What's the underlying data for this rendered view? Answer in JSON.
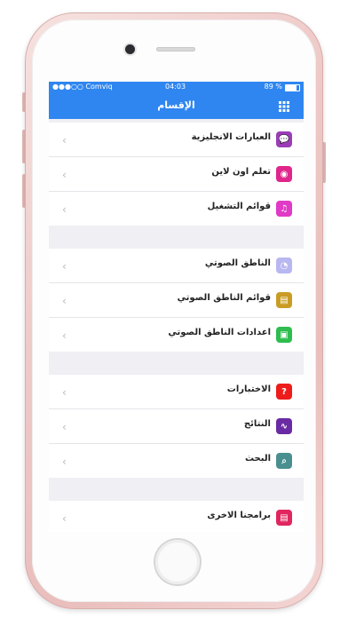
{
  "status": {
    "carrier": "●●●○○ Comviq",
    "time": "04:03",
    "battery": "89 %"
  },
  "nav": {
    "title": "الإقسام",
    "grid_icon": "grid-icon"
  },
  "colors": {
    "accent": "#2f86f0"
  },
  "groups": [
    [
      {
        "label": "العبارات الانجليزية",
        "icon": "chat-bubble-icon",
        "color": "#9b3db7"
      },
      {
        "label": "تعلم اون لاين",
        "icon": "planet-icon",
        "color": "#e0258c"
      },
      {
        "label": "قوائم التشغيل",
        "icon": "playlist-icon",
        "color": "#e03ac6"
      }
    ],
    [
      {
        "label": "الناطق الصوتي",
        "icon": "speaker-icon",
        "color": "#b9b7f0"
      },
      {
        "label": "قوائم الناطق الصوتي",
        "icon": "speech-list-icon",
        "color": "#c99c24"
      },
      {
        "label": "اعدادات الناطق الصوتي",
        "icon": "settings-phone-icon",
        "color": "#2ebd4e"
      }
    ],
    [
      {
        "label": "الاختبارات",
        "icon": "question-icon",
        "color": "#ee1b1b"
      },
      {
        "label": "النتائج",
        "icon": "chart-line-icon",
        "color": "#6a2aa3"
      },
      {
        "label": "البحث",
        "icon": "search-icon",
        "color": "#4a8f8f"
      }
    ],
    [
      {
        "label": "برامجنا الاخرى",
        "icon": "apps-list-icon",
        "color": "#e0265f"
      }
    ]
  ]
}
